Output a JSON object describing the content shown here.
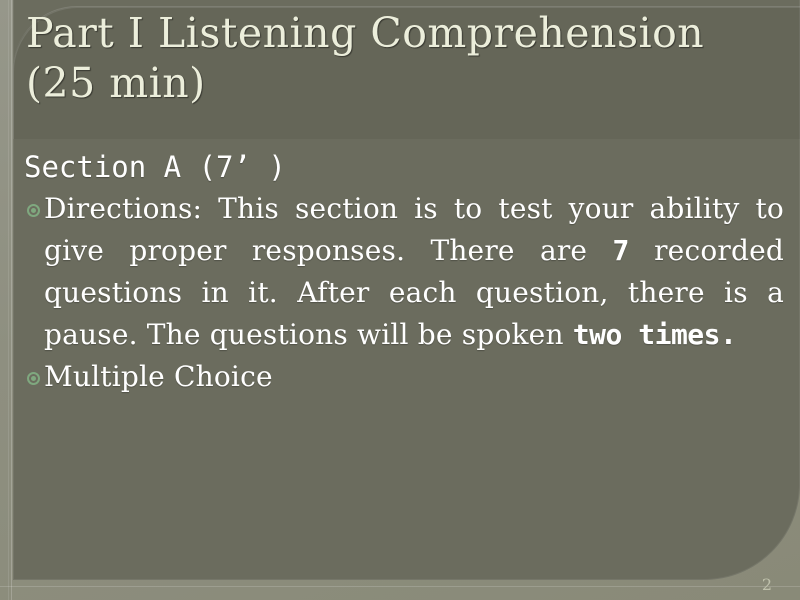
{
  "slide": {
    "title": "Part I Listening Comprehension (25 min)",
    "section_heading": "Section A (7’ )",
    "bullets": [
      {
        "icon": "target-bullet-icon",
        "text_before": "Directions: This section is to test your ability to give proper responses. There are ",
        "emphasis_1": "7",
        "text_middle": " recorded questions in it. After each question, there is a pause. The questions will be spoken ",
        "emphasis_2": "two times.",
        "text_after": ""
      },
      {
        "icon": "target-bullet-icon",
        "text": "Multiple Choice"
      }
    ],
    "page_number": "2",
    "colors": {
      "slide_background": "#8d8e7c",
      "body_panel": "#6b6c5e",
      "title_text": "#eceedb",
      "body_text": "#ffffff",
      "bullet_accent": "#7fa87f",
      "page_number_text": "#c9cbb5"
    }
  }
}
